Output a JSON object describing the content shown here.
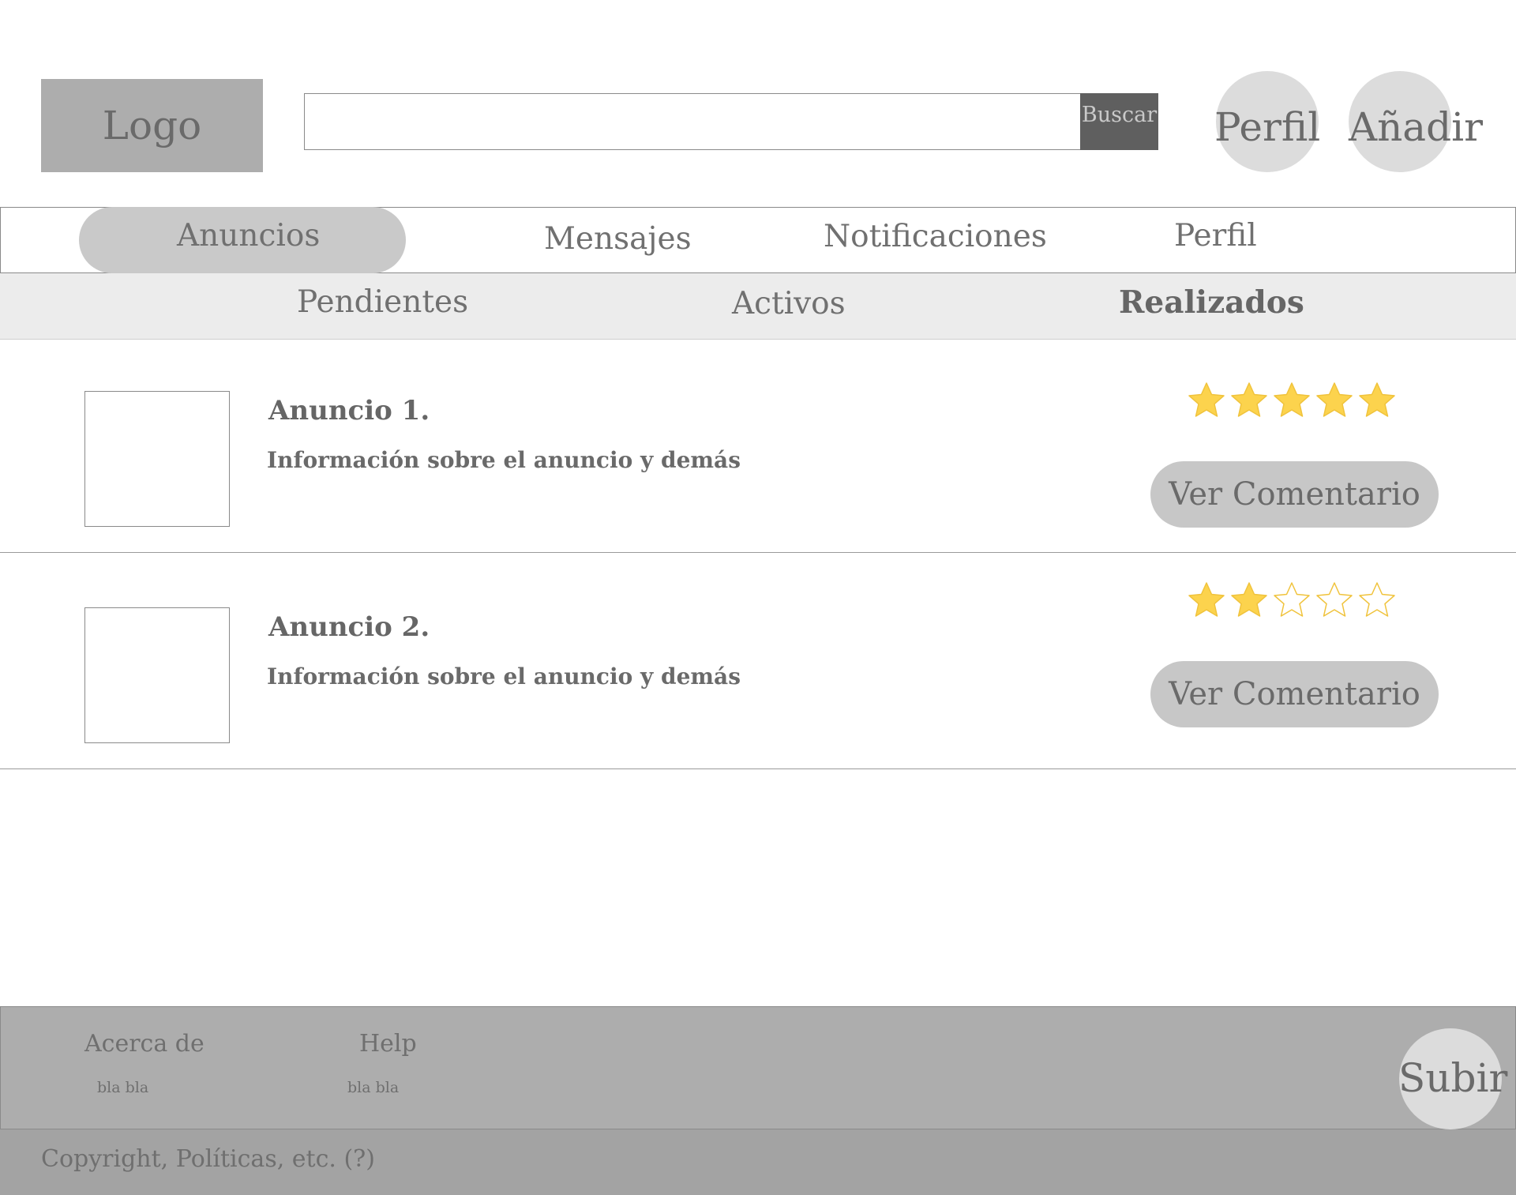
{
  "header": {
    "logo": "Logo",
    "search_value": "",
    "search_button": "Buscar",
    "profile_button": "Perfil",
    "add_button": "Añadir"
  },
  "main_nav": {
    "items": [
      {
        "label": "Anuncios",
        "active": true
      },
      {
        "label": "Mensajes",
        "active": false
      },
      {
        "label": "Notificaciones",
        "active": false
      },
      {
        "label": "Perfil",
        "active": false
      }
    ]
  },
  "sub_nav": {
    "items": [
      {
        "label": "Pendientes",
        "active": false
      },
      {
        "label": "Activos",
        "active": false
      },
      {
        "label": "Realizados",
        "active": true
      }
    ]
  },
  "listings": [
    {
      "title": "Anuncio 1.",
      "info": "Información sobre el anuncio y demás",
      "rating": 5,
      "max_rating": 5,
      "button": "Ver Comentario"
    },
    {
      "title": "Anuncio 2.",
      "info": "Información sobre el anuncio y demás",
      "rating": 2,
      "max_rating": 5,
      "button": "Ver Comentario"
    }
  ],
  "footer": {
    "about_heading": "Acerca de",
    "about_text": "bla bla",
    "help_heading": "Help",
    "help_text": "bla bla",
    "up_button": "Subir",
    "copyright": "Copyright, Políticas, etc. (?)"
  },
  "colors": {
    "star_filled": "#fcd34d",
    "star_stroke": "#f0c33c",
    "button_gray": "#c7c7c7",
    "footer_gray": "#adadad"
  }
}
